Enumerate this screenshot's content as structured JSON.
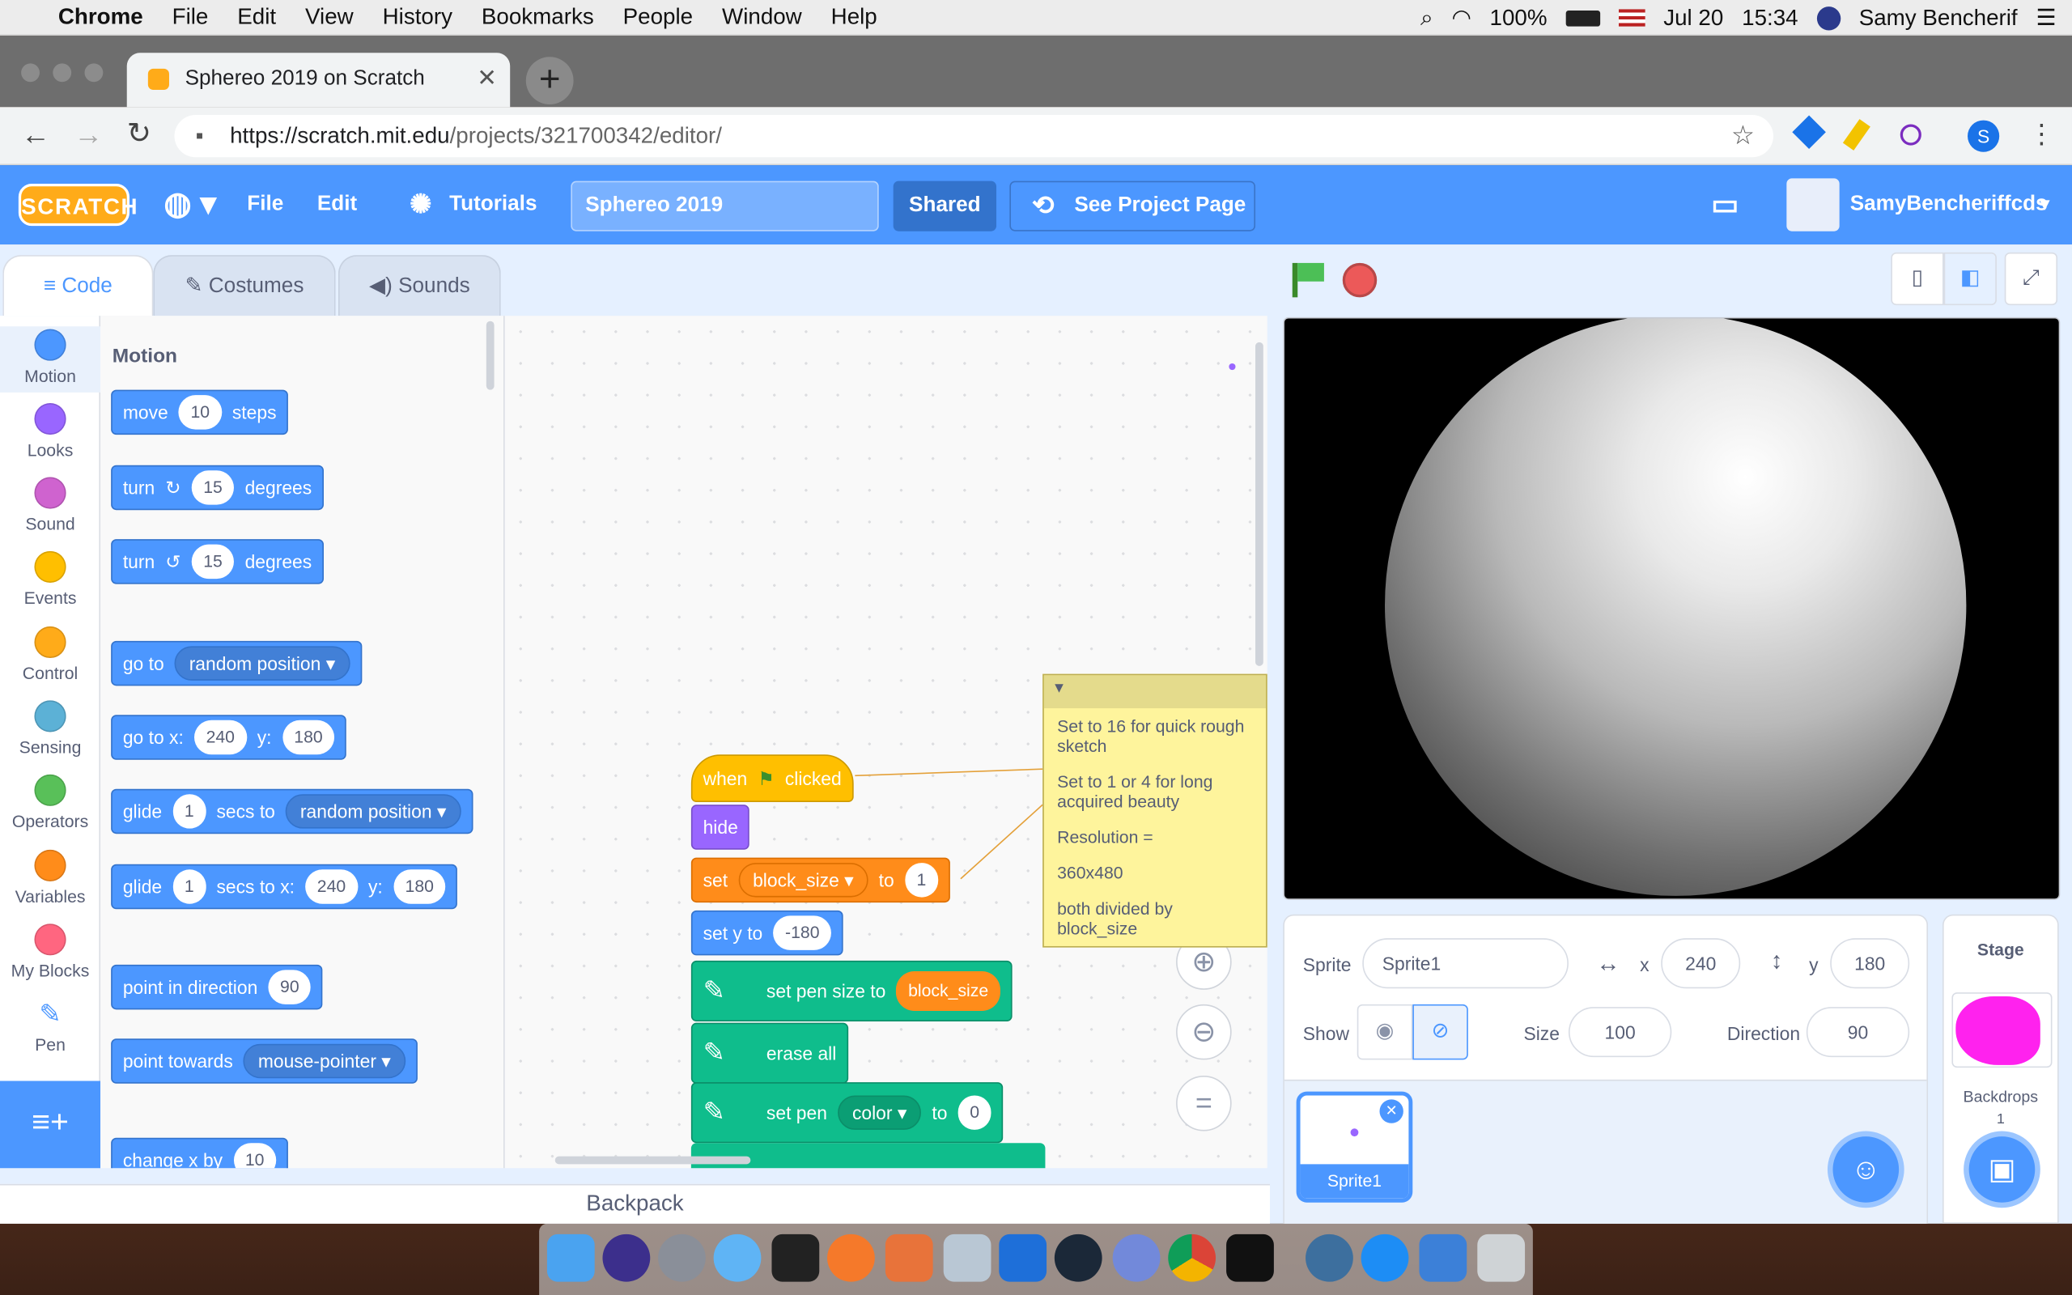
{
  "menubar": {
    "apple": "",
    "app": "Chrome",
    "items": [
      "File",
      "Edit",
      "View",
      "History",
      "Bookmarks",
      "People",
      "Window",
      "Help"
    ],
    "battery": "100%",
    "date": "Jul 20",
    "time": "15:34",
    "user": "Samy Bencherif"
  },
  "browser": {
    "tab_title": "Sphereo 2019 on Scratch",
    "url_host": "https://scratch.mit.edu",
    "url_path": "/projects/321700342/editor/",
    "profile_letter": "S"
  },
  "scratch_header": {
    "logo": "SCRATCH",
    "file": "File",
    "edit": "Edit",
    "tutorials": "Tutorials",
    "project_title": "Sphereo 2019",
    "shared": "Shared",
    "see_project_page": "See Project Page",
    "username": "SamyBencheriffcds"
  },
  "editor_tabs": [
    "Code",
    "Costumes",
    "Sounds"
  ],
  "categories": [
    {
      "label": "Motion",
      "color": "#4c97ff"
    },
    {
      "label": "Looks",
      "color": "#9966ff"
    },
    {
      "label": "Sound",
      "color": "#cf63cf"
    },
    {
      "label": "Events",
      "color": "#ffbf00"
    },
    {
      "label": "Control",
      "color": "#ffab19"
    },
    {
      "label": "Sensing",
      "color": "#5cb1d6"
    },
    {
      "label": "Operators",
      "color": "#59c059"
    },
    {
      "label": "Variables",
      "color": "#ff8c1a"
    },
    {
      "label": "My Blocks",
      "color": "#ff6680"
    },
    {
      "label": "Pen",
      "color": "#0fbd8c"
    }
  ],
  "palette": {
    "heading": "Motion",
    "move": {
      "a": "move",
      "v": "10",
      "b": "steps"
    },
    "turn_cw": {
      "a": "turn",
      "v": "15",
      "b": "degrees"
    },
    "turn_ccw": {
      "a": "turn",
      "v": "15",
      "b": "degrees"
    },
    "goto": {
      "a": "go to",
      "dd": "random position"
    },
    "gotoxy": {
      "a": "go to x:",
      "x": "240",
      "b": "y:",
      "y": "180"
    },
    "glide1": {
      "a": "glide",
      "v": "1",
      "b": "secs to",
      "dd": "random position"
    },
    "glide2": {
      "a": "glide",
      "v": "1",
      "b": "secs to x:",
      "x": "240",
      "c": "y:",
      "y": "180"
    },
    "point": {
      "a": "point in direction",
      "v": "90"
    },
    "towards": {
      "a": "point towards",
      "dd": "mouse-pointer"
    },
    "changex": {
      "a": "change x by",
      "v": "10"
    }
  },
  "script": {
    "when": {
      "a": "when",
      "b": "clicked"
    },
    "hide": "hide",
    "set": {
      "a": "set",
      "var": "block_size",
      "b": "to",
      "v": "1"
    },
    "sety": {
      "a": "set y to",
      "v": "-180"
    },
    "pensize": {
      "a": "set pen size to",
      "v": "block_size"
    },
    "erase": "erase all",
    "pencolor": {
      "a": "set pen",
      "dd": "color",
      "b": "to",
      "v": "0"
    }
  },
  "comment": [
    "Set to 16 for quick rough sketch",
    "Set to 1 or 4 for long acquired beauty",
    "Resolution =",
    "360x480",
    "both divided by block_size"
  ],
  "sprite_info": {
    "sprite_label": "Sprite",
    "sprite_name": "Sprite1",
    "x_label": "x",
    "x": "240",
    "y_label": "y",
    "y": "180",
    "show_label": "Show",
    "size_label": "Size",
    "size": "100",
    "direction_label": "Direction",
    "direction": "90"
  },
  "sprite_tile": "Sprite1",
  "stage_panel": {
    "title": "Stage",
    "backdrops_label": "Backdrops",
    "backdrops_count": "1"
  },
  "backpack": "Backpack"
}
